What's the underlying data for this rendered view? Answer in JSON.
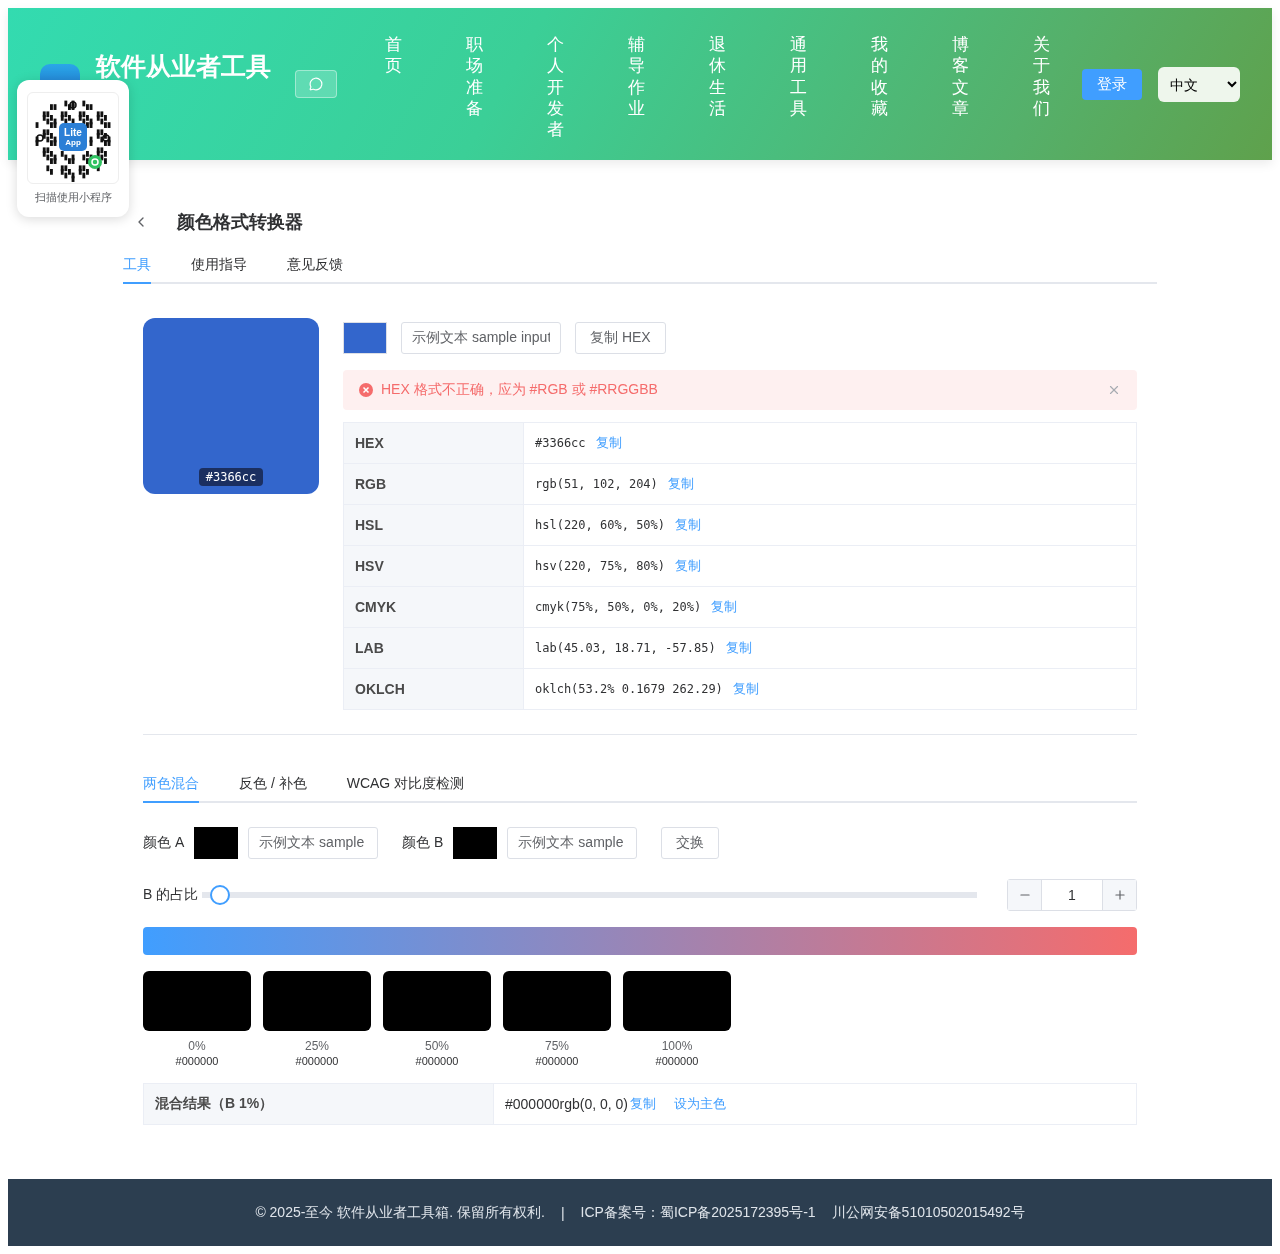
{
  "header": {
    "title": "软件从业者工具",
    "nav": [
      "首页",
      "职场准备",
      "个人开发者",
      "辅导作业",
      "退休生活",
      "通用工具",
      "我的收藏",
      "博客文章",
      "关于我们"
    ],
    "login": "登录",
    "language": "中文"
  },
  "qr_popup": {
    "logo_lines": [
      "Lite",
      "App"
    ],
    "caption": "扫描使用小程序"
  },
  "page": {
    "title": "颜色格式转换器",
    "tabs": [
      {
        "label": "工具",
        "selected": true
      },
      {
        "label": "使用指导",
        "selected": false
      },
      {
        "label": "意见反馈",
        "selected": false
      }
    ]
  },
  "converter": {
    "color": "#3366cc",
    "swatch_label": "#3366cc",
    "input_value": "示例文本 sample input",
    "copy_hex": "复制 HEX",
    "alert": {
      "message": "HEX 格式不正确，应为 #RGB 或 #RRGGBB"
    },
    "formats": [
      {
        "name": "HEX",
        "value": "#3366cc",
        "action": "复制"
      },
      {
        "name": "RGB",
        "value": "rgb(51, 102, 204)",
        "action": "复制"
      },
      {
        "name": "HSL",
        "value": "hsl(220, 60%, 50%)",
        "action": "复制"
      },
      {
        "name": "HSV",
        "value": "hsv(220, 75%, 80%)",
        "action": "复制"
      },
      {
        "name": "CMYK",
        "value": "cmyk(75%, 50%, 0%, 20%)",
        "action": "复制"
      },
      {
        "name": "LAB",
        "value": "lab(45.03, 18.71, -57.85)",
        "action": "复制"
      },
      {
        "name": "OKLCH",
        "value": "oklch(53.2% 0.1679 262.29)",
        "action": "复制"
      }
    ]
  },
  "mixer": {
    "tabs": [
      {
        "label": "两色混合",
        "selected": true
      },
      {
        "label": "反色 / 补色",
        "selected": false
      },
      {
        "label": "WCAG 对比度检测",
        "selected": false
      }
    ],
    "colors": [
      {
        "label": "颜色 A",
        "color": "#000000",
        "input_value": "示例文本 sample"
      },
      {
        "label": "颜色 B",
        "color": "#000000",
        "input_value": "示例文本 sample"
      }
    ],
    "swap": "交换",
    "ratio": {
      "label": "B 的占比",
      "level": 0.01,
      "value": "1"
    },
    "steps": [
      {
        "percent": "0%",
        "hex": "#000000",
        "color": "#000000"
      },
      {
        "percent": "25%",
        "hex": "#000000",
        "color": "#000000"
      },
      {
        "percent": "50%",
        "hex": "#000000",
        "color": "#000000"
      },
      {
        "percent": "75%",
        "hex": "#000000",
        "color": "#000000"
      },
      {
        "percent": "100%",
        "hex": "#000000",
        "color": "#000000"
      }
    ],
    "result": {
      "label": "混合结果（B 1%）",
      "value": "#000000rgb(0, 0, 0)",
      "copy": "复制",
      "set_primary": "设为主色"
    }
  },
  "footer": {
    "items": [
      "© 2025-至今 软件从业者工具箱. 保留所有权利.",
      "|",
      "ICP备案号：蜀ICP备2025172395号-1",
      "川公网安备51010502015492号"
    ]
  }
}
